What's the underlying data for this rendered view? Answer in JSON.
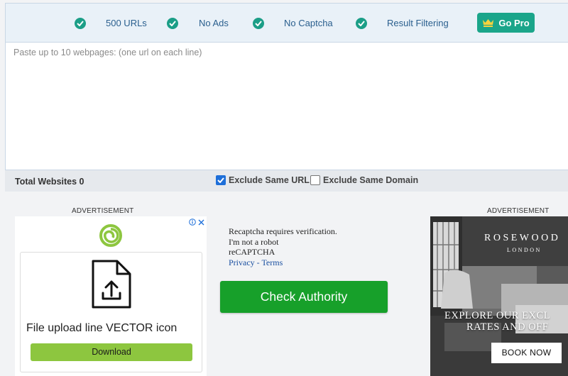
{
  "pro_bar": {
    "features": [
      {
        "label": "500 URLs"
      },
      {
        "label": "No Ads"
      },
      {
        "label": "No Captcha"
      },
      {
        "label": "Result Filtering"
      }
    ],
    "go_pro_label": "Go Pro"
  },
  "url_input": {
    "placeholder": "Paste up to 10 webpages: (one url on each line)",
    "value": ""
  },
  "options": {
    "total_label": "Total Websites 0",
    "exclude_same_url": {
      "label": "Exclude Same URL",
      "checked": true
    },
    "exclude_same_domain": {
      "label": "Exclude Same Domain",
      "checked": false
    }
  },
  "ads": {
    "left_header": "ADVERTISEMENT",
    "right_header": "ADVERTISEMENT",
    "left": {
      "title": "File upload line VECTOR icon",
      "button": "Download"
    },
    "right": {
      "brand": "ROSEWOOD",
      "city": "LONDON",
      "headline_line1": "EXPLORE OUR EXCL",
      "headline_line2": "RATES AND OFF",
      "button": "BOOK NOW"
    }
  },
  "recaptcha": {
    "line1": "Recaptcha requires verification.",
    "line2": "I'm not a robot",
    "line3": "reCAPTCHA",
    "privacy": "Privacy",
    "separator": " - ",
    "terms": "Terms"
  },
  "check_button": "Check Authority",
  "colors": {
    "accent_teal": "#1aa58a",
    "check_green": "#17a02a",
    "link_blue": "#2a5f8e",
    "download_green": "#8dc63f"
  }
}
